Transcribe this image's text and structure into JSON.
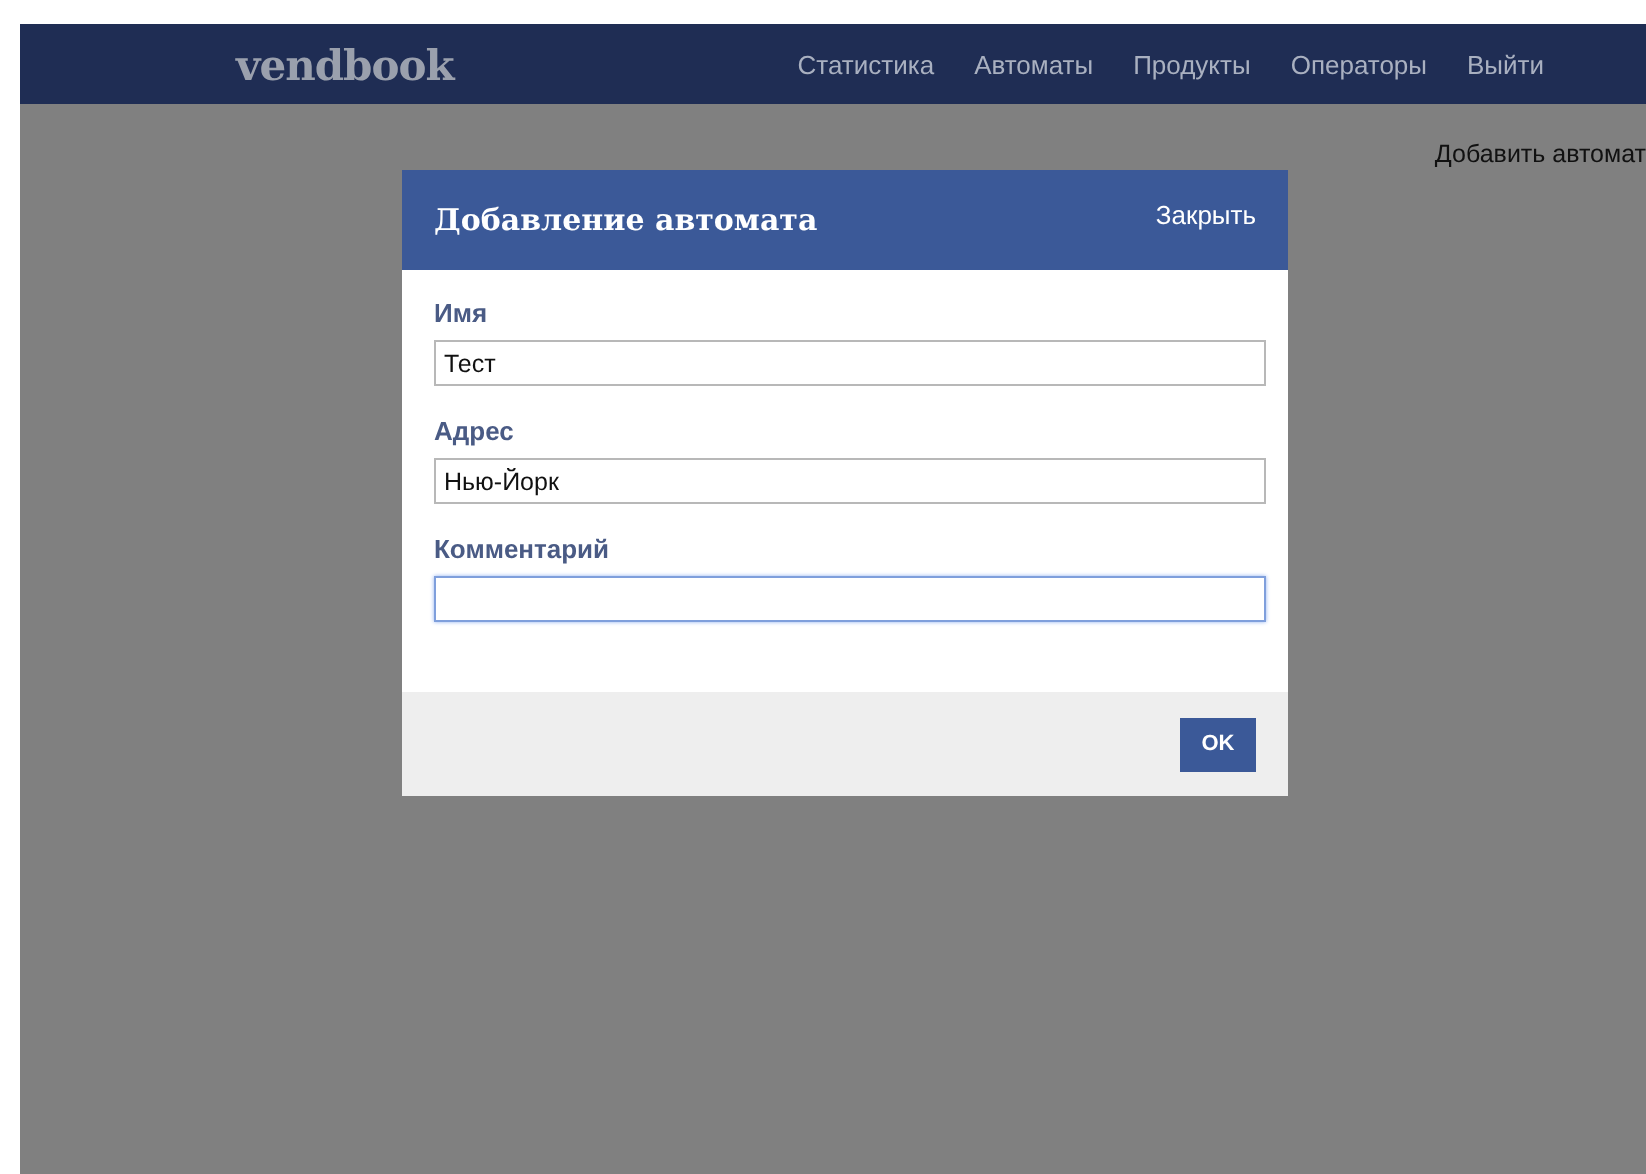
{
  "navbar": {
    "brand": "vendbook",
    "links": [
      {
        "label": "Статистика"
      },
      {
        "label": "Автоматы"
      },
      {
        "label": "Продукты"
      },
      {
        "label": "Операторы"
      },
      {
        "label": "Выйти"
      }
    ]
  },
  "add_link": "Добавить автомат",
  "dialog": {
    "title": "Добавление автомата",
    "close": "Закрыть",
    "fields": [
      {
        "label": "Имя",
        "value": "Тест",
        "focused": false
      },
      {
        "label": "Адрес",
        "value": "Нью-Йорк",
        "focused": false
      },
      {
        "label": "Комментарий",
        "focused": true
      }
    ],
    "ok": "OK"
  }
}
